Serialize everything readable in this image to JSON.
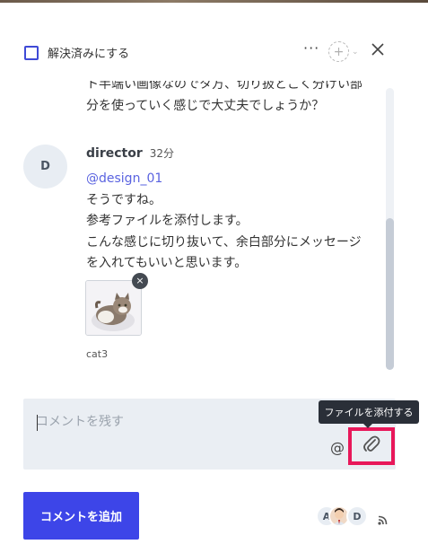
{
  "header": {
    "resolve_label": "解決済みにする",
    "more_label": "···"
  },
  "thread": {
    "previous_text": "ト半端い画像なのでタ方、切り扱とこく分けい部分を使っていく感じで大丈夫でしょうか？",
    "message": {
      "avatar_initial": "D",
      "author": "director",
      "time": "32分",
      "mention": "@design_01",
      "lines": [
        "そうですね。",
        "参考ファイルを添付します。",
        "こんな感じに切り抜いて、余白部分にメッセージを入れてもいいと思います。"
      ],
      "attachment": {
        "name": "cat3",
        "remove_glyph": "×"
      }
    }
  },
  "composer": {
    "placeholder": "コメントを残す",
    "value": "",
    "at_label": "@",
    "attach_tooltip": "ファイルを添付する"
  },
  "footer": {
    "add_button_label": "コメントを追加",
    "participants": [
      "A",
      "D"
    ]
  },
  "colors": {
    "accent": "#3d45e8",
    "highlight": "#e8185a",
    "mention": "#5a63e0"
  }
}
